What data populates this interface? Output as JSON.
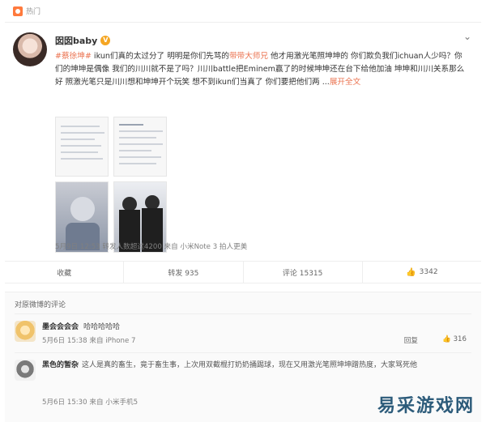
{
  "hot_label": "热门",
  "post": {
    "username": "囡囡baby",
    "badge": "V",
    "more_icon": "chevron-down-icon",
    "text_parts": [
      {
        "t": "#蔡徐坤#",
        "c": "tag"
      },
      {
        "t": " ikun们真的太过分了 明明是你们先骂的",
        "c": ""
      },
      {
        "t": "带带大师兄",
        "c": "hl"
      },
      {
        "t": " 他才用激光笔照坤坤的 你们欺负我们ichuan人少吗？你们的坤坤是偶像 我们的川川就不是了吗？川川battle把Eminem赢了的时候坤坤还在台下给他加油 坤坤和川川关系那么好 照激光笔只是川川想和坤坤开个玩笑 想不到ikun们当真了 你们要把他们两 ...",
        "c": ""
      },
      {
        "t": "展开全文",
        "c": "expand"
      }
    ],
    "meta": "5月9日 12:53 转发人数超过4200 来自 小米Note 3 拍人更美"
  },
  "actions": {
    "favorite": "收藏",
    "repost": "转发 935",
    "comment": "评论 15315",
    "like": "3342"
  },
  "comments_title": "对原微博的评论",
  "comments": [
    {
      "name": "墨会会会会",
      "text": "哈哈哈哈哈",
      "time": "5月6日 15:38 来自 iPhone 7",
      "reply": "回复",
      "likes": "316"
    },
    {
      "name": "黑色的暂杂",
      "text": "这人是真的畜生，竟于畜生事，上次用双截棍打奶奶捅踢球，现在又用激光笔照坤坤蹭热度，大家骂死他",
      "time": "5月6日 15:30 来自 小米手机5"
    }
  ],
  "watermark": "易采游戏网"
}
